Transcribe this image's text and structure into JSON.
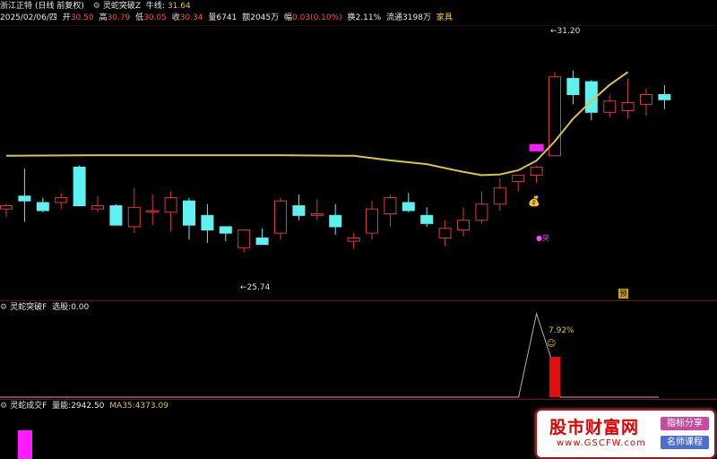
{
  "header1": {
    "stock": "浙江正特",
    "period": "(日线 前复权)",
    "date": "2025/02/06/四",
    "open_label": "开",
    "open": "30.50",
    "high_label": "高",
    "high": "30.79",
    "low_label": "低",
    "low": "30.05",
    "close_label": "收",
    "close": "30.34",
    "vol_label": "量",
    "vol": "6741",
    "amount_label": "额",
    "amount": "2045万",
    "change_label": "幅",
    "change": "0.03(0.10%)",
    "turnover_label": "换",
    "turnover": "2.11%",
    "float_label": "流通",
    "float": "3198万",
    "industry": "家具",
    "indicator": "灵蛇突破Z",
    "niuxian_label": "牛线:",
    "niuxian": "31.64"
  },
  "header2": {
    "indicator": "灵蛇突破F",
    "select_label": "选股:",
    "select": "0.00"
  },
  "header3": {
    "indicator": "灵蛇成交F",
    "vol_label": "量能:",
    "vol": "2942.50",
    "ma_label": "MA35:",
    "ma": "4373.09"
  },
  "annotations": {
    "high_marker": "31.20",
    "low_marker": "25.74",
    "sub_pct": "7.92%",
    "pre_mark": "预",
    "tu_mark": "突"
  },
  "watermark": {
    "title": "股市财富网",
    "url": "www.GSCFW.com",
    "btn1": "指标分享",
    "btn2": "名师课程"
  },
  "colors": {
    "up": "#d93a3a",
    "down": "#5ff0f0",
    "niuxian": "#d8c44a",
    "magenta": "#ff1aff",
    "subline": "#b0b0b0",
    "subbar": "#e01010"
  },
  "chart_data": [
    {
      "type": "candlestick",
      "title": "灵蛇突破Z",
      "ylim": [
        24.2,
        32.6
      ],
      "candles": [
        {
          "o": 26.95,
          "h": 27.1,
          "l": 26.7,
          "c": 27.05
        },
        {
          "o": 27.35,
          "h": 28.2,
          "l": 26.55,
          "c": 27.2
        },
        {
          "o": 27.15,
          "h": 27.3,
          "l": 26.85,
          "c": 26.9
        },
        {
          "o": 27.15,
          "h": 27.45,
          "l": 26.95,
          "c": 27.3
        },
        {
          "o": 28.25,
          "h": 28.3,
          "l": 27.5,
          "c": 27.05
        },
        {
          "o": 26.95,
          "h": 27.35,
          "l": 26.85,
          "c": 27.05
        },
        {
          "o": 27.05,
          "h": 27.1,
          "l": 26.5,
          "c": 26.45
        },
        {
          "o": 26.4,
          "h": 27.6,
          "l": 26.2,
          "c": 27.0
        },
        {
          "o": 26.9,
          "h": 27.4,
          "l": 26.45,
          "c": 26.9
        },
        {
          "o": 26.85,
          "h": 27.5,
          "l": 26.25,
          "c": 27.3
        },
        {
          "o": 27.2,
          "h": 27.3,
          "l": 26.0,
          "c": 26.45
        },
        {
          "o": 26.75,
          "h": 27.1,
          "l": 25.9,
          "c": 26.3
        },
        {
          "o": 26.4,
          "h": 26.4,
          "l": 25.95,
          "c": 26.2
        },
        {
          "o": 25.75,
          "h": 26.3,
          "l": 25.6,
          "c": 26.3
        },
        {
          "o": 26.05,
          "h": 26.35,
          "l": 25.9,
          "c": 25.85
        },
        {
          "o": 26.2,
          "h": 27.3,
          "l": 26.0,
          "c": 27.2
        },
        {
          "o": 27.05,
          "h": 27.4,
          "l": 26.6,
          "c": 26.75
        },
        {
          "o": 26.75,
          "h": 27.25,
          "l": 26.6,
          "c": 26.8
        },
        {
          "o": 26.75,
          "h": 27.1,
          "l": 26.15,
          "c": 26.4
        },
        {
          "o": 25.95,
          "h": 26.2,
          "l": 25.7,
          "c": 26.05
        },
        {
          "o": 26.2,
          "h": 27.2,
          "l": 26.0,
          "c": 26.95
        },
        {
          "o": 26.8,
          "h": 27.4,
          "l": 26.4,
          "c": 27.3
        },
        {
          "o": 27.15,
          "h": 27.45,
          "l": 26.85,
          "c": 26.9
        },
        {
          "o": 26.75,
          "h": 27.0,
          "l": 26.4,
          "c": 26.5
        },
        {
          "o": 26.05,
          "h": 26.6,
          "l": 25.8,
          "c": 26.35
        },
        {
          "o": 26.3,
          "h": 27.0,
          "l": 26.1,
          "c": 26.6
        },
        {
          "o": 26.6,
          "h": 27.5,
          "l": 26.5,
          "c": 27.1
        },
        {
          "o": 27.1,
          "h": 27.9,
          "l": 26.9,
          "c": 27.6
        },
        {
          "o": 27.8,
          "h": 28.0,
          "l": 27.5,
          "c": 28.0
        },
        {
          "o": 28.0,
          "h": 28.3,
          "l": 27.75,
          "c": 28.25
        },
        {
          "o": 28.6,
          "h": 31.2,
          "l": 28.6,
          "c": 31.05
        },
        {
          "o": 31.0,
          "h": 31.25,
          "l": 30.2,
          "c": 30.5
        },
        {
          "o": 30.9,
          "h": 30.95,
          "l": 29.7,
          "c": 29.95
        },
        {
          "o": 29.95,
          "h": 30.5,
          "l": 29.8,
          "c": 30.3
        },
        {
          "o": 30.0,
          "h": 31.0,
          "l": 29.75,
          "c": 30.25
        },
        {
          "o": 30.2,
          "h": 30.7,
          "l": 29.85,
          "c": 30.5
        },
        {
          "o": 30.5,
          "h": 30.79,
          "l": 30.05,
          "c": 30.34
        }
      ],
      "niuxian_line": [
        {
          "i": 0,
          "v": 28.6
        },
        {
          "i": 5,
          "v": 28.62
        },
        {
          "i": 10,
          "v": 28.62
        },
        {
          "i": 15,
          "v": 28.62
        },
        {
          "i": 19,
          "v": 28.6
        },
        {
          "i": 21,
          "v": 28.46
        },
        {
          "i": 23,
          "v": 28.34
        },
        {
          "i": 25,
          "v": 28.1
        },
        {
          "i": 26,
          "v": 28.0
        },
        {
          "i": 27,
          "v": 28.02
        },
        {
          "i": 28,
          "v": 28.15
        },
        {
          "i": 29,
          "v": 28.45
        },
        {
          "i": 30,
          "v": 29.05
        },
        {
          "i": 31,
          "v": 29.75
        },
        {
          "i": 32,
          "v": 30.3
        },
        {
          "i": 33,
          "v": 30.8
        },
        {
          "i": 34,
          "v": 31.2
        }
      ]
    },
    {
      "type": "line",
      "title": "灵蛇突破F",
      "select_spike_index": 29,
      "select_bar_index": 30,
      "select_bar_value": 1
    },
    {
      "type": "bar",
      "title": "灵蛇成交F",
      "vol": 2942.5,
      "ma35": 4373.09
    }
  ]
}
